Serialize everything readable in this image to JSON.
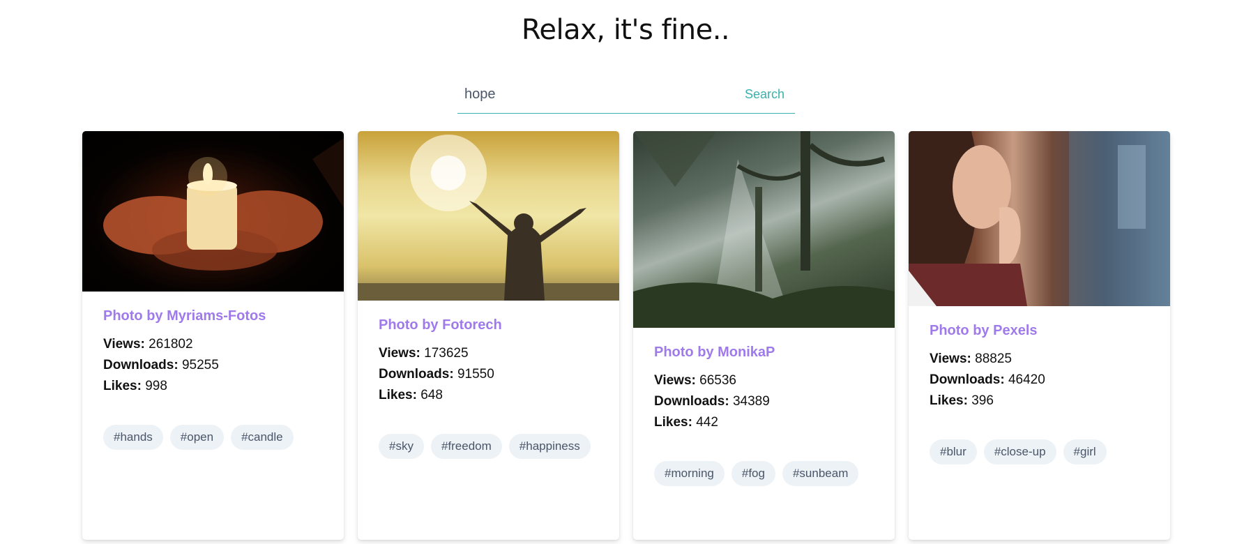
{
  "header": {
    "title": "Relax, it's fine.."
  },
  "search": {
    "value": "hope",
    "button_label": "Search"
  },
  "colors": {
    "accent": "#38b2ac",
    "author": "#9f7aea",
    "tag_bg": "#edf2f7"
  },
  "cards": [
    {
      "author": "Photo by Myriams-Fotos",
      "views_label": "Views:",
      "views": "261802",
      "downloads_label": "Downloads:",
      "downloads": "95255",
      "likes_label": "Likes:",
      "likes": "998",
      "tags": [
        "#hands",
        "#open",
        "#candle"
      ]
    },
    {
      "author": "Photo by Fotorech",
      "views_label": "Views:",
      "views": "173625",
      "downloads_label": "Downloads:",
      "downloads": "91550",
      "likes_label": "Likes:",
      "likes": "648",
      "tags": [
        "#sky",
        "#freedom",
        "#happiness"
      ]
    },
    {
      "author": "Photo by MonikaP",
      "views_label": "Views:",
      "views": "66536",
      "downloads_label": "Downloads:",
      "downloads": "34389",
      "likes_label": "Likes:",
      "likes": "442",
      "tags": [
        "#morning",
        "#fog",
        "#sunbeam"
      ]
    },
    {
      "author": "Photo by Pexels",
      "views_label": "Views:",
      "views": "88825",
      "downloads_label": "Downloads:",
      "downloads": "46420",
      "likes_label": "Likes:",
      "likes": "396",
      "tags": [
        "#blur",
        "#close-up",
        "#girl"
      ]
    }
  ]
}
